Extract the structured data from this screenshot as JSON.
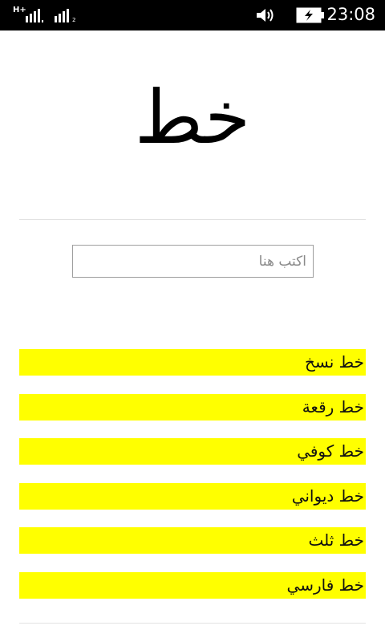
{
  "status_bar": {
    "network_type": "H+",
    "sim2_label": "2",
    "time": "23:08"
  },
  "icons": [
    "signal-icon",
    "volume-icon",
    "battery-charging-icon"
  ],
  "colors": {
    "status_bar_bg": "#000000",
    "item_bg": "#ffff00",
    "divider": "#e2e2e2"
  },
  "header": {
    "title": "خط"
  },
  "input": {
    "placeholder": "اكتب هنا",
    "value": ""
  },
  "font_list": {
    "items": [
      "خط نسخ",
      "خط رقعة",
      "خط كوفي",
      "خط ديواني",
      "خط ثلث",
      "خط فارسي"
    ]
  }
}
